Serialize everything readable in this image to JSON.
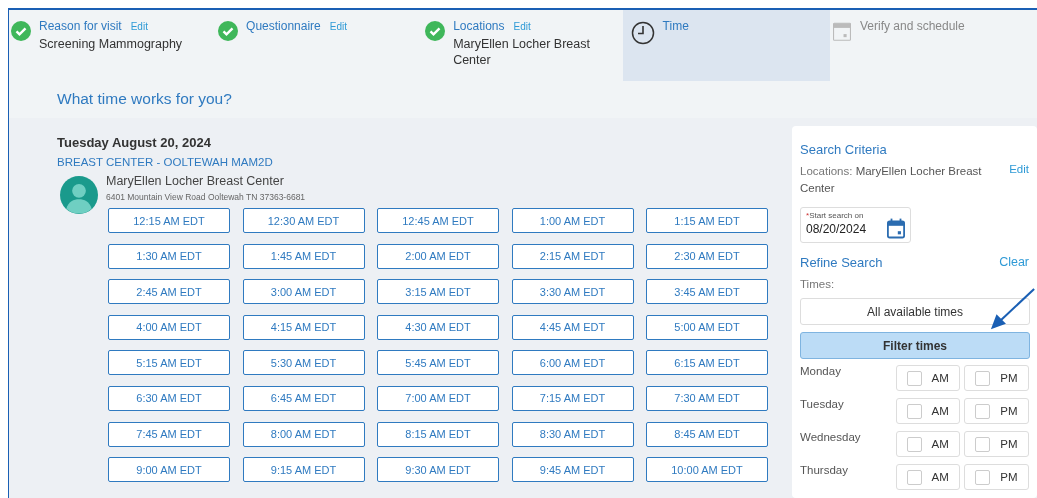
{
  "steps": [
    {
      "label": "Reason for visit",
      "edit": "Edit",
      "detail": "Screening Mammography",
      "kind": "done",
      "selected": false
    },
    {
      "label": "Questionnaire",
      "edit": "Edit",
      "kind": "done",
      "selected": false
    },
    {
      "label": "Locations",
      "edit": "Edit",
      "detail": "MaryEllen Locher Breast Center",
      "kind": "done",
      "selected": false
    },
    {
      "label": "Time",
      "kind": "current",
      "selected": true
    },
    {
      "label": "Verify and schedule",
      "kind": "upcoming",
      "selected": false
    }
  ],
  "heading": "What time works for you?",
  "date": "Tuesday August 20, 2024",
  "department": "BREAST CENTER - OOLTEWAH MAM2D",
  "location": {
    "name": "MaryEllen Locher Breast Center",
    "address": "6401 Mountain View Road Ooltewah TN 37363-6681"
  },
  "times": [
    "12:15 AM EDT",
    "12:30 AM EDT",
    "12:45 AM EDT",
    "1:00 AM EDT",
    "1:15 AM EDT",
    "1:30 AM EDT",
    "1:45 AM EDT",
    "2:00 AM EDT",
    "2:15 AM EDT",
    "2:30 AM EDT",
    "2:45 AM EDT",
    "3:00 AM EDT",
    "3:15 AM EDT",
    "3:30 AM EDT",
    "3:45 AM EDT",
    "4:00 AM EDT",
    "4:15 AM EDT",
    "4:30 AM EDT",
    "4:45 AM EDT",
    "5:00 AM EDT",
    "5:15 AM EDT",
    "5:30 AM EDT",
    "5:45 AM EDT",
    "6:00 AM EDT",
    "6:15 AM EDT",
    "6:30 AM EDT",
    "6:45 AM EDT",
    "7:00 AM EDT",
    "7:15 AM EDT",
    "7:30 AM EDT",
    "7:45 AM EDT",
    "8:00 AM EDT",
    "8:15 AM EDT",
    "8:30 AM EDT",
    "8:45 AM EDT",
    "9:00 AM EDT",
    "9:15 AM EDT",
    "9:30 AM EDT",
    "9:45 AM EDT",
    "10:00 AM EDT"
  ],
  "sidebar": {
    "title": "Search Criteria",
    "locations_label": "Locations:",
    "locations_value": "MaryEllen Locher Breast Center",
    "edit": "Edit",
    "start_field": {
      "required_mark": "*",
      "label": "Start search on",
      "value": "08/20/2024"
    },
    "refine_title": "Refine Search",
    "clear": "Clear",
    "times_label": "Times:",
    "time_options": [
      {
        "label": "All available times",
        "selected": false
      },
      {
        "label": "Filter times",
        "selected": true
      }
    ],
    "days": [
      {
        "name": "Monday",
        "am": {
          "label": "AM",
          "checked": false
        },
        "pm": {
          "label": "PM",
          "checked": false
        }
      },
      {
        "name": "Tuesday",
        "am": {
          "label": "AM",
          "checked": false
        },
        "pm": {
          "label": "PM",
          "checked": false
        }
      },
      {
        "name": "Wednesday",
        "am": {
          "label": "AM",
          "checked": false
        },
        "pm": {
          "label": "PM",
          "checked": false
        }
      },
      {
        "name": "Thursday",
        "am": {
          "label": "AM",
          "checked": false
        },
        "pm": {
          "label": "PM",
          "checked": false
        }
      }
    ]
  }
}
